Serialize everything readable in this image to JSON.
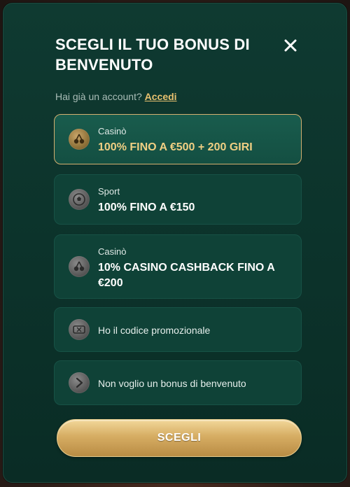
{
  "modal": {
    "title": "SCEGLI IL TUO BONUS DI BENVENUTO",
    "account_prompt": "Hai già un account?",
    "login_link": "Accedi"
  },
  "options": [
    {
      "label": "Casinò",
      "value": "100% FINO A €500 + 200 GIRI",
      "icon": "cherries-icon",
      "selected": true
    },
    {
      "label": "Sport",
      "value": "100% FINO A €150",
      "icon": "soccer-ball-icon",
      "selected": false
    },
    {
      "label": "Casinò",
      "value": "10% CASINO CASHBACK FINO A €200",
      "icon": "cherries-icon",
      "selected": false
    },
    {
      "text": "Ho il codice promozionale",
      "icon": "ticket-icon"
    },
    {
      "text": "Non voglio un bonus di benvenuto",
      "icon": "chevron-right-icon"
    }
  ],
  "cta": {
    "label": "SCEGLI"
  },
  "colors": {
    "modal_bg": "#0c332b",
    "option_bg": "#0f4237",
    "accent_gold": "#d4b070",
    "selected_text": "#f0cf83"
  }
}
